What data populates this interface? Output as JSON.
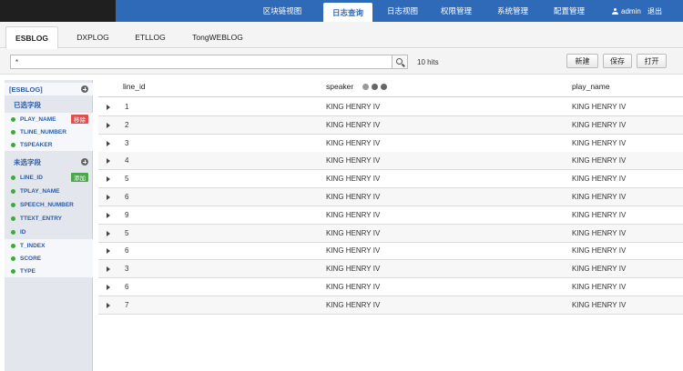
{
  "nav": {
    "items": [
      "区块链视图",
      "日志查询",
      "日志视图",
      "权限管理",
      "系统管理",
      "配置管理"
    ],
    "active": 1,
    "user": "admin",
    "logout": "退出"
  },
  "tabs": [
    "ESBLOG",
    "DXPLOG",
    "ETLLOG",
    "TongWEBLOG"
  ],
  "search": {
    "value": "*",
    "hits": "10 hits"
  },
  "toolbar": {
    "new_label": "新建",
    "save_label": "保存",
    "open_label": "打开"
  },
  "sidebar": {
    "index_label": "[ESBLOG]",
    "selected_title": "已选字段",
    "selected_fields": [
      "PLAY_NAME",
      "TLINE_NUMBER",
      "TSPEAKER"
    ],
    "remove_label": "移除",
    "unselected_title": "未选字段",
    "unselected_fields": [
      "LINE_ID",
      "TPLAY_NAME",
      "SPEECH_NUMBER",
      "TTEXT_ENTRY",
      "ID",
      "T_INDEX",
      "SCORE",
      "TYPE"
    ],
    "add_label": "添加"
  },
  "table": {
    "columns": [
      "line_id",
      "speaker",
      "play_name"
    ],
    "rows": [
      {
        "line_id": "1",
        "speaker": "KING HENRY IV",
        "play_name": "KING HENRY IV"
      },
      {
        "line_id": "2",
        "speaker": "KING HENRY IV",
        "play_name": "KING HENRY IV"
      },
      {
        "line_id": "3",
        "speaker": "KING HENRY IV",
        "play_name": "KING HENRY IV"
      },
      {
        "line_id": "4",
        "speaker": "KING HENRY IV",
        "play_name": "KING HENRY IV"
      },
      {
        "line_id": "5",
        "speaker": "KING HENRY IV",
        "play_name": "KING HENRY IV"
      },
      {
        "line_id": "6",
        "speaker": "KING HENRY IV",
        "play_name": "KING HENRY IV"
      },
      {
        "line_id": "9",
        "speaker": "KING HENRY IV",
        "play_name": "KING HENRY IV"
      },
      {
        "line_id": "5",
        "speaker": "KING HENRY IV",
        "play_name": "KING HENRY IV"
      },
      {
        "line_id": "6",
        "speaker": "KING HENRY IV",
        "play_name": "KING HENRY IV"
      },
      {
        "line_id": "3",
        "speaker": "KING HENRY IV",
        "play_name": "KING HENRY IV"
      },
      {
        "line_id": "6",
        "speaker": "KING HENRY IV",
        "play_name": "KING HENRY IV"
      },
      {
        "line_id": "7",
        "speaker": "KING HENRY IV",
        "play_name": "KING HENRY IV"
      }
    ]
  },
  "colors": {
    "nav_bg": "#2f6ab8",
    "accent": "#2b5ca8",
    "remove": "#e05050",
    "add": "#4aa84a",
    "field_dot": "#3cab3c"
  }
}
